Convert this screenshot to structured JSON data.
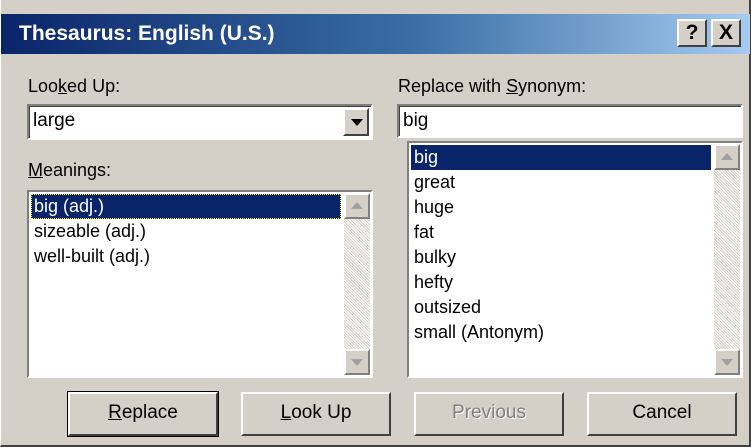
{
  "window": {
    "title": "Thesaurus: English (U.S.)",
    "help_button": "?",
    "close_button": "X"
  },
  "looked_up": {
    "label_pre": "Loo",
    "label_accel": "k",
    "label_post": "ed Up:",
    "value": "large"
  },
  "meanings": {
    "label_accel": "M",
    "label_post": "eanings:",
    "items": [
      "big (adj.)",
      "sizeable (adj.)",
      "well-built (adj.)"
    ],
    "selected_index": 0
  },
  "replace_with": {
    "label_pre": "Replace with ",
    "label_accel": "S",
    "label_post": "ynonym:",
    "value": "big",
    "synonyms": [
      "big",
      "great",
      "huge",
      "fat",
      "bulky",
      "hefty",
      "outsized",
      "small (Antonym)"
    ],
    "selected_index": 0
  },
  "buttons": {
    "replace_accel": "R",
    "replace_rest": "eplace",
    "lookup_accel": "L",
    "lookup_rest": "ook Up",
    "previous": "Previous",
    "cancel": "Cancel"
  },
  "colors": {
    "dialog_face": "#d4d0c8",
    "title_gradient_start": "#0a246a",
    "title_gradient_end": "#a6caf0",
    "selection": "#0a246a"
  }
}
